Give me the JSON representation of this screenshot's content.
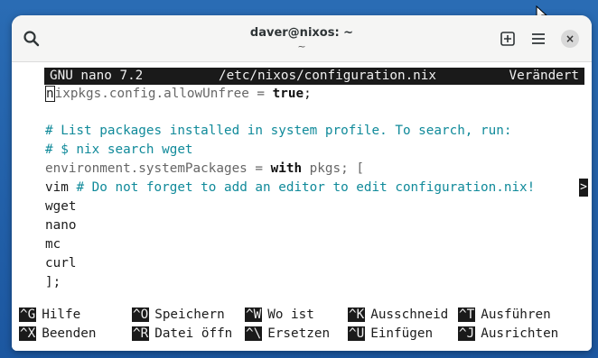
{
  "window": {
    "title": "daver@nixos: ~",
    "subtitle": "~",
    "close_label": "×"
  },
  "nano": {
    "version": "GNU nano 7.2",
    "file": "/etc/nixos/configuration.nix",
    "status": "Verändert"
  },
  "editor": {
    "line1_cursor_char": "n",
    "line1_rest": "ixpkgs.config.allowUnfree = ",
    "line1_true": "true",
    "line1_end": ";",
    "line3": "# List packages installed in system profile. To search, run:",
    "line4": "# $ nix search wget",
    "line5_a": "environment.systemPackages = ",
    "line5_with": "with",
    "line5_b": " pkgs; [",
    "line6_a": "vim ",
    "line6_comment": "# Do not forget to add an editor to edit configuration.nix!",
    "line6_more": ">",
    "line7": "wget",
    "line8": "nano",
    "line9": "mc",
    "line10": "curl",
    "line11": "];"
  },
  "shortcuts_row1": [
    {
      "key": "^G",
      "label": "Hilfe"
    },
    {
      "key": "^O",
      "label": "Speichern"
    },
    {
      "key": "^W",
      "label": "Wo ist"
    },
    {
      "key": "^K",
      "label": "Ausschneid"
    },
    {
      "key": "^T",
      "label": "Ausführen"
    }
  ],
  "shortcuts_row2": [
    {
      "key": "^X",
      "label": "Beenden"
    },
    {
      "key": "^R",
      "label": "Datei öffn"
    },
    {
      "key": "^\\",
      "label": "Ersetzen"
    },
    {
      "key": "^U",
      "label": "Einfügen"
    },
    {
      "key": "^J",
      "label": "Ausrichten"
    }
  ],
  "icons": {
    "search": "search-icon",
    "new_tab": "new-tab-icon",
    "menu": "hamburger-menu-icon",
    "close": "close-icon",
    "cursor": "mouse-pointer-icon"
  },
  "colors": {
    "desktop": "#1f5fa6",
    "terminal_bg": "#ffffff",
    "nano_bar": "#1a1a1a",
    "comment": "#108a9a"
  }
}
